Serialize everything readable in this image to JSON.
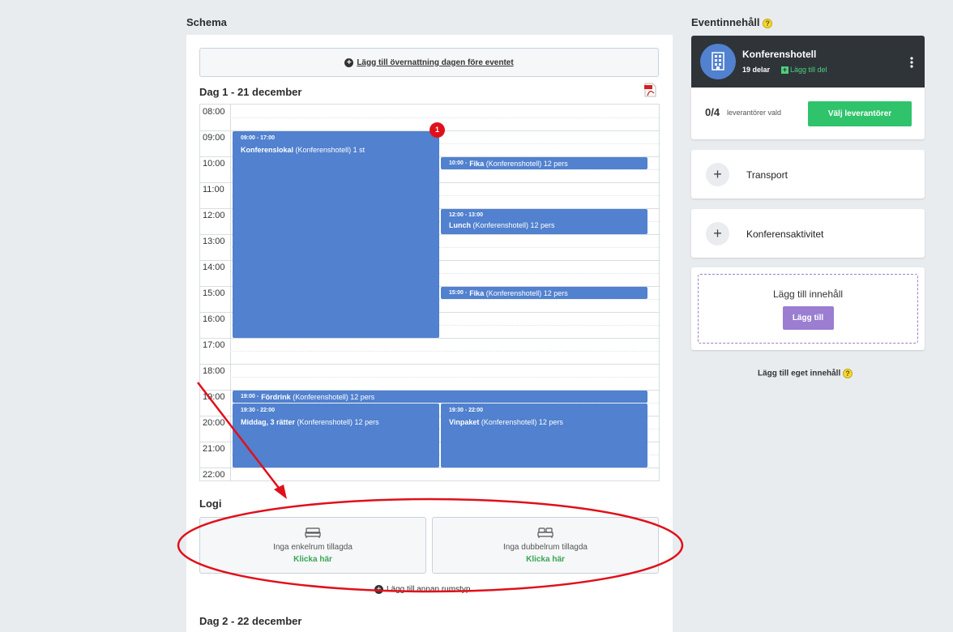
{
  "schedule": {
    "title": "Schema",
    "add_overnight_label": "Lägg till övernattning dagen före eventet",
    "day1_title": "Dag 1 - 21 december",
    "day2_title": "Dag 2 - 22 december",
    "hours": [
      "08:00",
      "09:00",
      "10:00",
      "11:00",
      "12:00",
      "13:00",
      "14:00",
      "15:00",
      "16:00",
      "17:00",
      "18:00",
      "19:00",
      "20:00",
      "21:00",
      "22:00"
    ],
    "badge_count": "1",
    "events": [
      {
        "time": "09:00 - 17:00",
        "title": "Konferenslokal",
        "detail": " (Konferenshotell) 1 st"
      },
      {
        "time": "10:00 -",
        "title": "Fika",
        "detail": " (Konferenshotell) 12 pers"
      },
      {
        "time": "12:00 - 13:00",
        "title": "Lunch",
        "detail": " (Konferenshotell) 12 pers"
      },
      {
        "time": "15:00 -",
        "title": "Fika",
        "detail": " (Konferenshotell) 12 pers"
      },
      {
        "time": "19:00 -",
        "title": "Fördrink",
        "detail": " (Konferenshotell) 12 pers"
      },
      {
        "time": "19:30 - 22:00",
        "title": "Middag, 3 rätter",
        "detail": " (Konferenshotell) 12 pers"
      },
      {
        "time": "19:30 - 22:00",
        "title": "Vinpaket",
        "detail": " (Konferenshotell) 12 pers"
      }
    ]
  },
  "lodging": {
    "title": "Logi",
    "single_text": "Inga enkelrum tillagda",
    "double_text": "Inga dubbelrum tillagda",
    "click_here": "Klicka här",
    "add_roomtype": "Lägg till annan rumstyp"
  },
  "event_content": {
    "title": "Eventinnehåll",
    "help": "?",
    "hotel_name": "Konferenshotell",
    "parts": "19 delar",
    "add_part": "Lägg till del",
    "suppliers_count": "0/4",
    "suppliers_label": "leverantörer vald",
    "choose_suppliers": "Välj leverantörer",
    "transport": "Transport",
    "activity": "Konferensaktivitet",
    "add_content_text": "Lägg till innehåll",
    "add_button": "Lägg till",
    "own_content": "Lägg till eget innehåll"
  },
  "colors": {
    "event_blue": "#5181cf",
    "green": "#2fc36b",
    "purple": "#9b7dd1",
    "annotation_red": "#e0101a"
  }
}
